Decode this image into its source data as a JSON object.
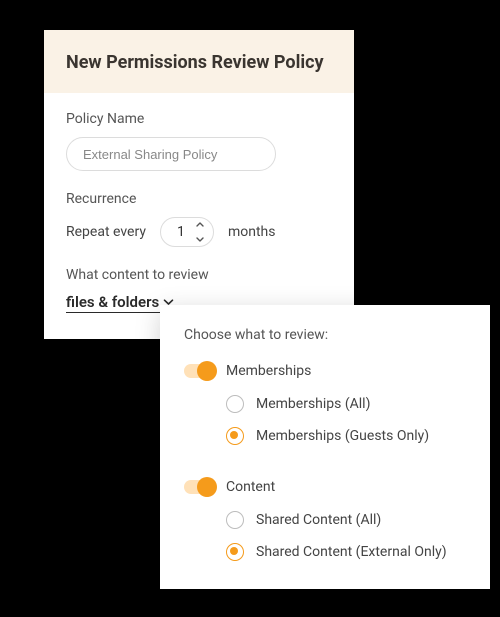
{
  "panel": {
    "title": "New Permissions Review Policy",
    "policy_name": {
      "label": "Policy Name",
      "value": "External Sharing Policy"
    },
    "recurrence": {
      "label": "Recurrence",
      "prefix": "Repeat every",
      "value": "1",
      "unit": "months"
    },
    "content": {
      "label": "What content to review",
      "selected": "files & folders"
    }
  },
  "popover": {
    "title": "Choose what to review:",
    "groups": [
      {
        "label": "Memberships",
        "on": true,
        "options": [
          {
            "label": "Memberships (All)",
            "selected": false
          },
          {
            "label": "Memberships (Guests Only)",
            "selected": true
          }
        ]
      },
      {
        "label": "Content",
        "on": true,
        "options": [
          {
            "label": "Shared Content (All)",
            "selected": false
          },
          {
            "label": "Shared Content (External Only)",
            "selected": true
          }
        ]
      }
    ]
  },
  "colors": {
    "accent": "#f59b1b",
    "header_bg": "#faf2e6"
  }
}
